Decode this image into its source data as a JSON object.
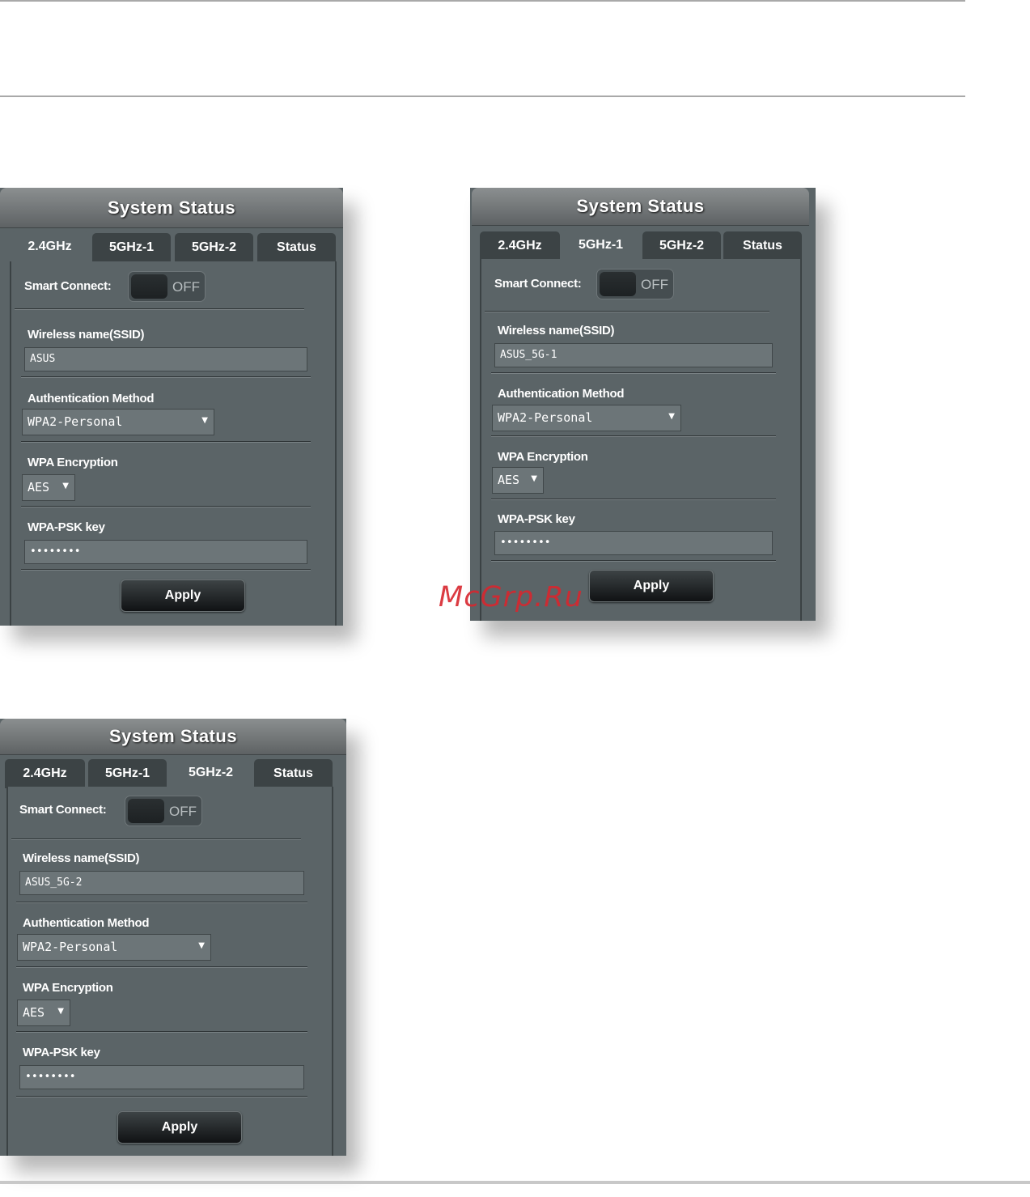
{
  "panels": [
    {
      "title": "System Status",
      "tabs": [
        "2.4GHz",
        "5GHz-1",
        "5GHz-2",
        "Status"
      ],
      "active_tab": "2.4GHz",
      "smart_connect_label": "Smart Connect:",
      "smart_connect_state": "OFF",
      "ssid_label": "Wireless name(SSID)",
      "ssid_value": "ASUS",
      "auth_label": "Authentication Method",
      "auth_value": "WPA2-Personal",
      "enc_label": "WPA Encryption",
      "enc_value": "AES",
      "psk_label": "WPA-PSK key",
      "psk_value": "••••••••",
      "apply_label": "Apply"
    },
    {
      "title": "System Status",
      "tabs": [
        "2.4GHz",
        "5GHz-1",
        "5GHz-2",
        "Status"
      ],
      "active_tab": "5GHz-1",
      "smart_connect_label": "Smart Connect:",
      "smart_connect_state": "OFF",
      "ssid_label": "Wireless name(SSID)",
      "ssid_value": "ASUS_5G-1",
      "auth_label": "Authentication Method",
      "auth_value": "WPA2-Personal",
      "enc_label": "WPA Encryption",
      "enc_value": "AES",
      "psk_label": "WPA-PSK key",
      "psk_value": "••••••••",
      "apply_label": "Apply"
    },
    {
      "title": "System Status",
      "tabs": [
        "2.4GHz",
        "5GHz-1",
        "5GHz-2",
        "Status"
      ],
      "active_tab": "5GHz-2",
      "smart_connect_label": "Smart Connect:",
      "smart_connect_state": "OFF",
      "ssid_label": "Wireless name(SSID)",
      "ssid_value": "ASUS_5G-2",
      "auth_label": "Authentication Method",
      "auth_value": "WPA2-Personal",
      "enc_label": "WPA Encryption",
      "enc_value": "AES",
      "psk_label": "WPA-PSK key",
      "psk_value": "••••••••",
      "apply_label": "Apply"
    }
  ],
  "watermark": "McGrp.Ru"
}
